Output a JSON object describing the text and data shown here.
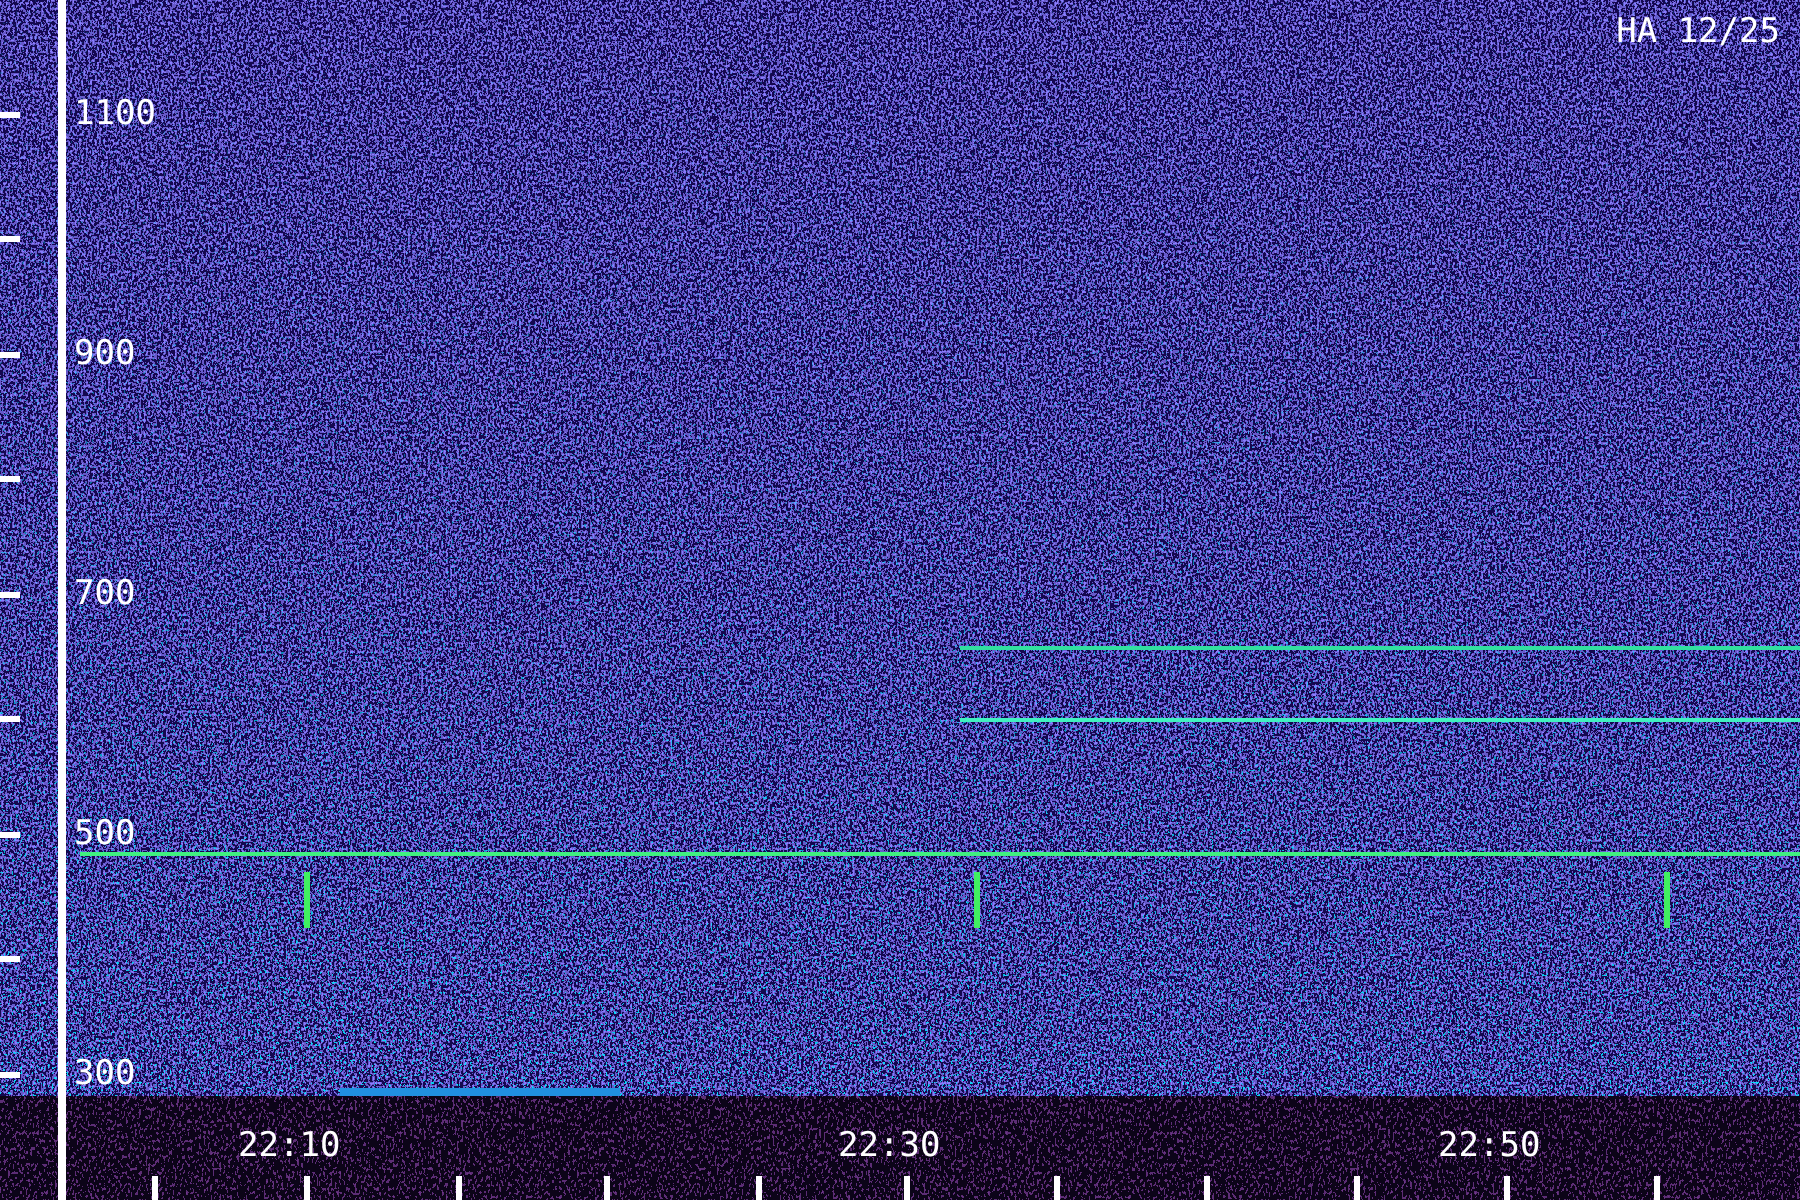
{
  "title": "HA 12/25",
  "y_axis": {
    "labels": [
      "1100",
      "900",
      "700",
      "500",
      "300"
    ]
  },
  "x_axis": {
    "labels": [
      "22:10",
      "22:30",
      "22:50"
    ]
  }
}
